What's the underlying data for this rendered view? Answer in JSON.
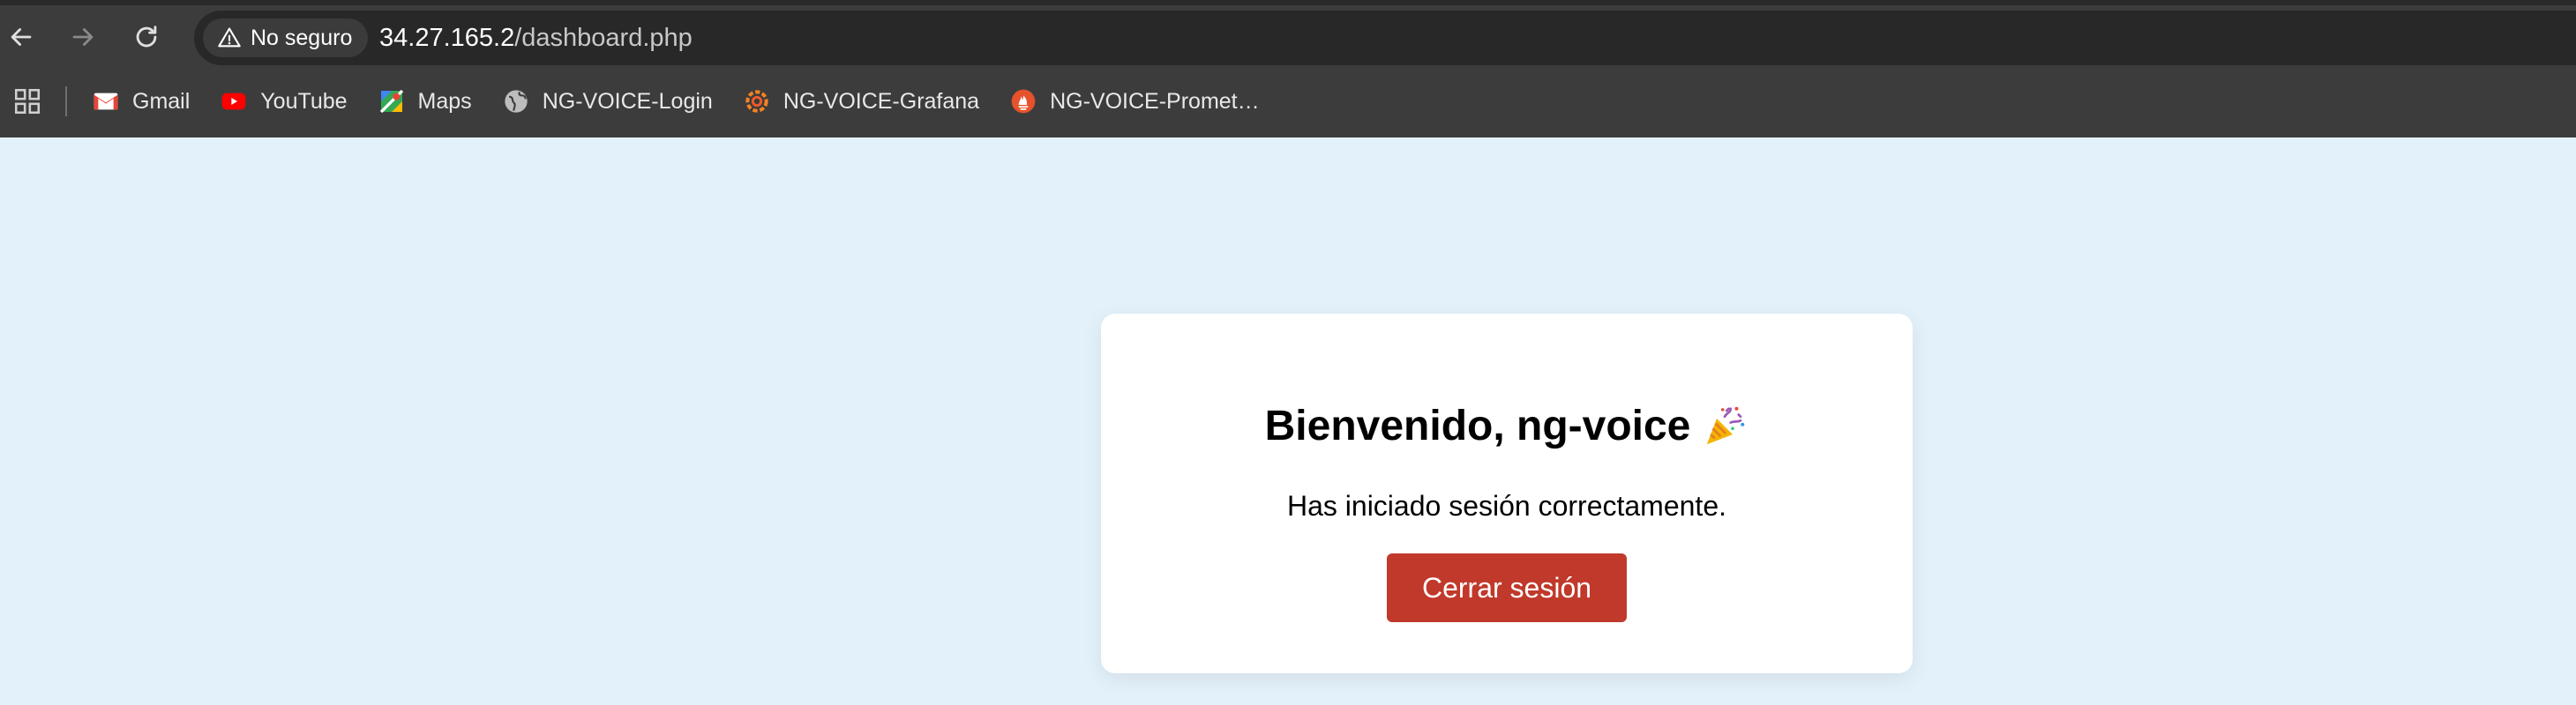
{
  "browser": {
    "security_label": "No seguro",
    "url_host": "34.27.165.2",
    "url_path": "/dashboard.php",
    "bookmarks": [
      {
        "label": "Gmail",
        "icon": "gmail-icon"
      },
      {
        "label": "YouTube",
        "icon": "youtube-icon"
      },
      {
        "label": "Maps",
        "icon": "maps-icon"
      },
      {
        "label": "NG-VOICE-Login",
        "icon": "globe-icon"
      },
      {
        "label": "NG-VOICE-Grafana",
        "icon": "grafana-icon"
      },
      {
        "label": "NG-VOICE-Promet…",
        "icon": "prometheus-icon"
      }
    ]
  },
  "page": {
    "title": "Bienvenido, ng-voice",
    "title_icon": "party-popper-icon",
    "message": "Has iniciado sesión correctamente.",
    "logout_label": "Cerrar sesión"
  },
  "colors": {
    "page_background": "#e3f1fb",
    "card_background": "#ffffff",
    "logout_button": "#c0392b",
    "toolbar": "#3c3c3c",
    "omnibox": "#282828"
  }
}
